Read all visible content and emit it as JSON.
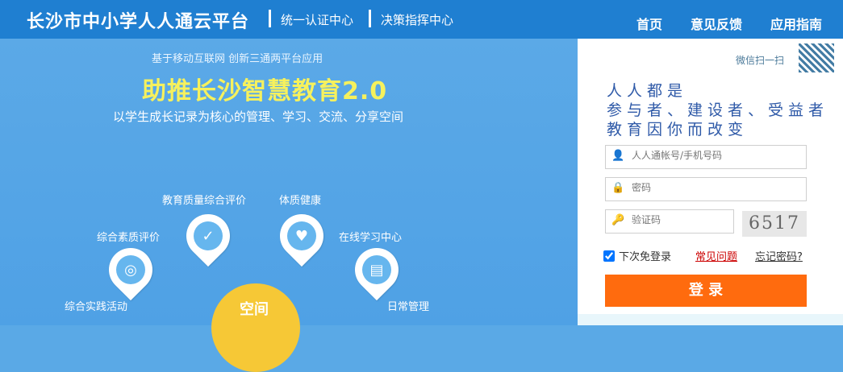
{
  "header": {
    "brand": "长沙市中小学人人通云平台",
    "links": [
      "统一认证中心",
      "决策指挥中心"
    ],
    "nav": [
      "首页",
      "意见反馈",
      "应用指南"
    ]
  },
  "hero": {
    "top_line": "基于移动互联网  创新三通两平台应用",
    "title": "助推长沙智慧教育2.0",
    "subtitle": "以学生成长记录为核心的管理、学习、交流、分享空间",
    "features": [
      "教育质量综合评价",
      "体质健康",
      "综合素质评价",
      "在线学习中心",
      "综合实践活动",
      "日常管理"
    ],
    "center_label": "空间"
  },
  "login": {
    "wechat_scan": "微信扫一扫",
    "slogan": [
      "人人都是",
      "参与者、建设者、受益者",
      "教育因你而改变"
    ],
    "username_placeholder": "人人通帐号/手机号码",
    "password_placeholder": "密码",
    "captcha_placeholder": "验证码",
    "captcha_text": "6517",
    "remember_label": "下次免登录",
    "faq_link": "常见问题",
    "forgot_link": "忘记密码?",
    "login_button": "登 录"
  }
}
